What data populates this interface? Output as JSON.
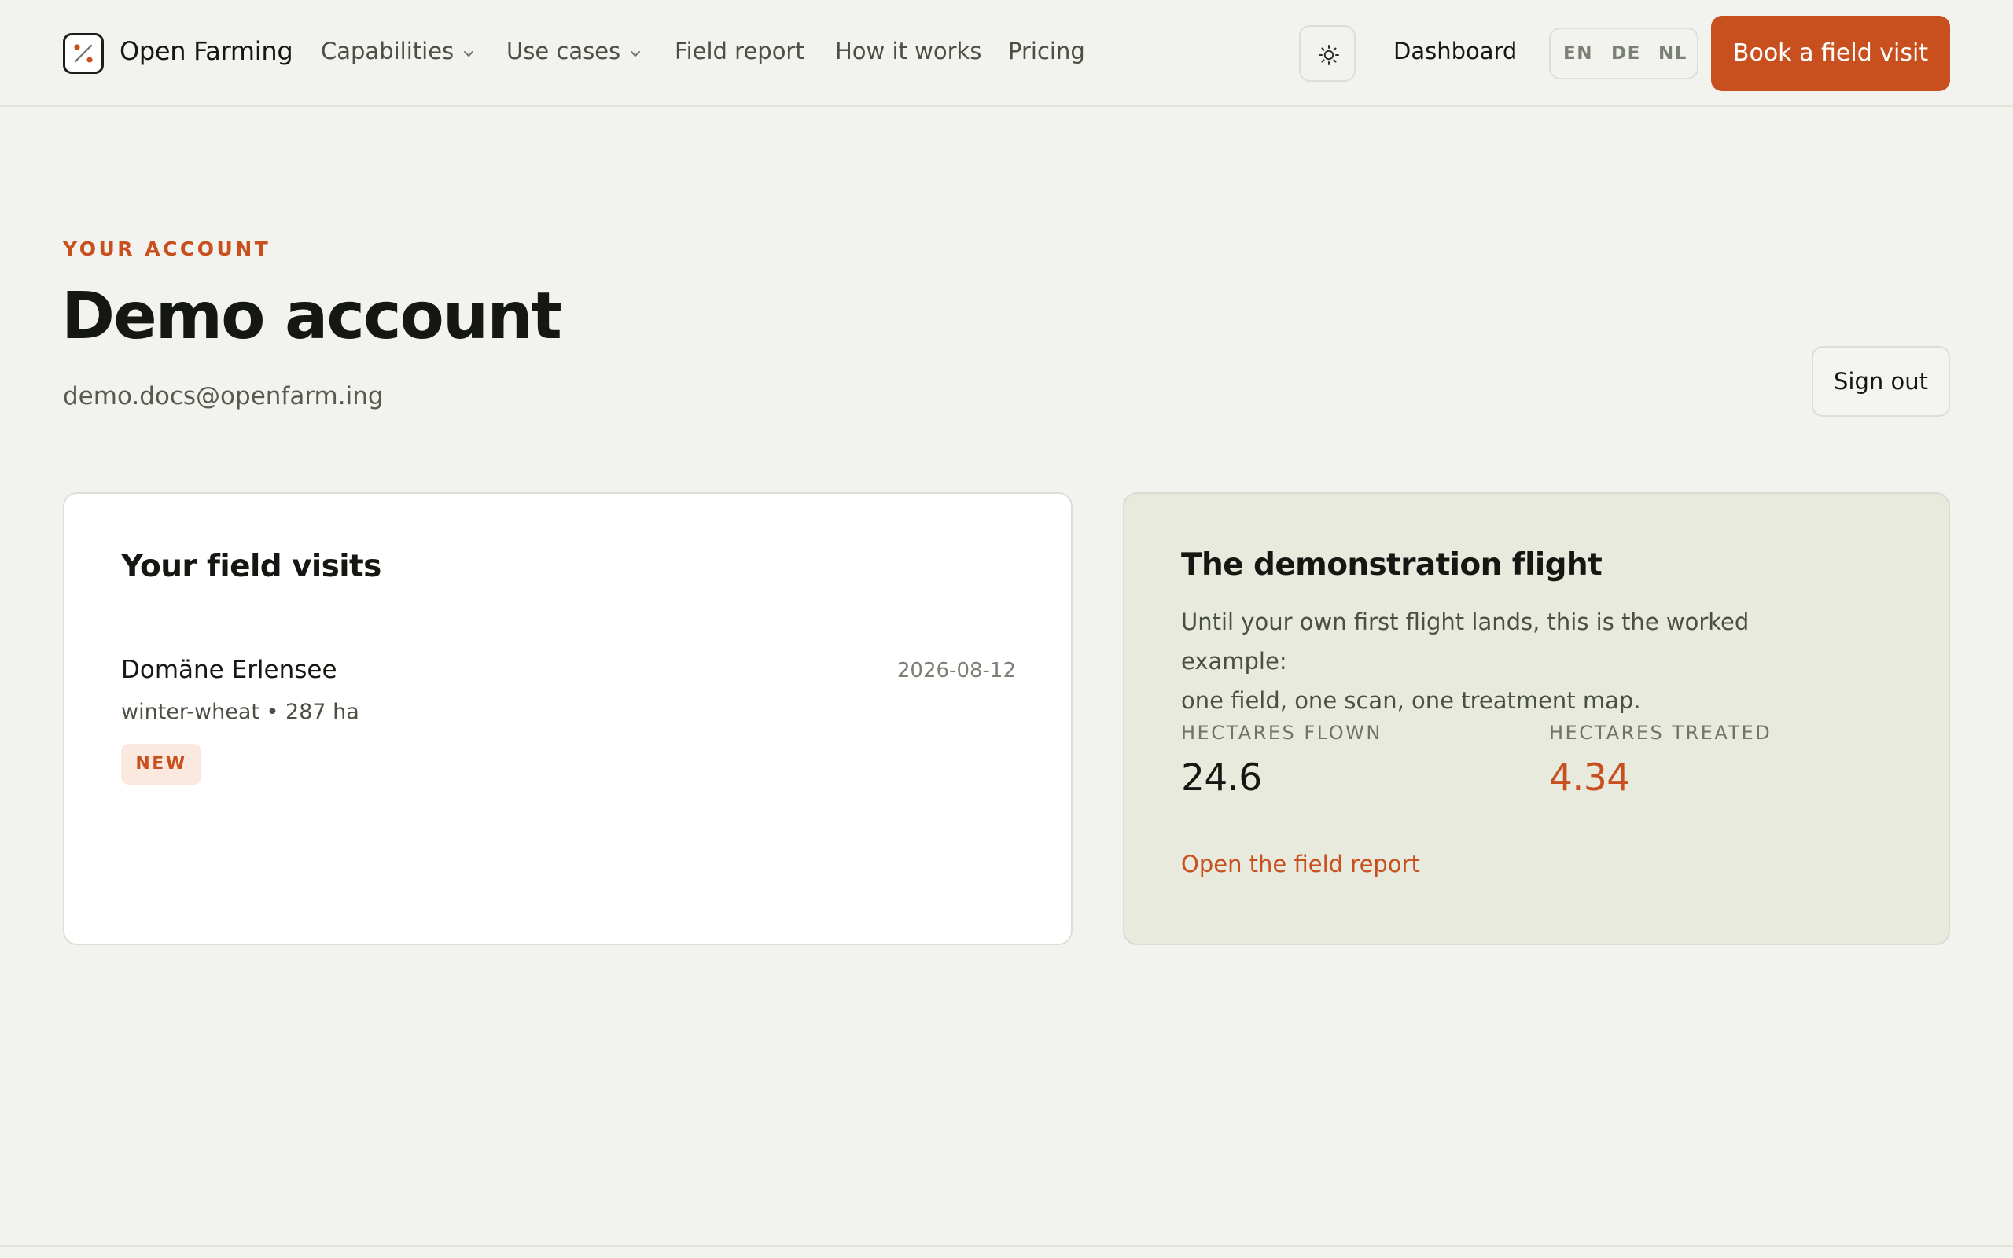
{
  "header": {
    "brand": "Open Farming",
    "logo_icon": "logo-icon",
    "nav": {
      "capabilities": "Capabilities",
      "use_cases": "Use cases",
      "field_report": "Field report",
      "how_it_works": "How it works",
      "pricing": "Pricing"
    },
    "theme_icon": "sun-icon",
    "dashboard": "Dashboard",
    "languages": [
      "EN",
      "DE",
      "NL"
    ],
    "cta": "Book a field visit"
  },
  "account": {
    "eyebrow": "YOUR ACCOUNT",
    "title": "Demo account",
    "email": "demo.docs@openfarm.ing",
    "sign_out": "Sign out"
  },
  "visits": {
    "title": "Your field visits",
    "items": [
      {
        "name": "Domäne Erlensee",
        "date": "2026-08-12",
        "meta": "winter-wheat • 287 ha",
        "badge": "NEW"
      }
    ]
  },
  "demo": {
    "title": "The demonstration flight",
    "description_line1": "Until your own first flight lands, this is the worked example:",
    "description_line2": "one field, one scan, one treatment map.",
    "stats": [
      {
        "label": "HECTARES FLOWN",
        "value": "24.6"
      },
      {
        "label": "HECTARES TREATED",
        "value": "4.34"
      }
    ],
    "link": "Open the field report"
  },
  "colors": {
    "accent": "#c8501f",
    "background": "#f2f3ee",
    "card": "#ffffff",
    "demo_card": "#e7eadd",
    "text": "#141712"
  }
}
